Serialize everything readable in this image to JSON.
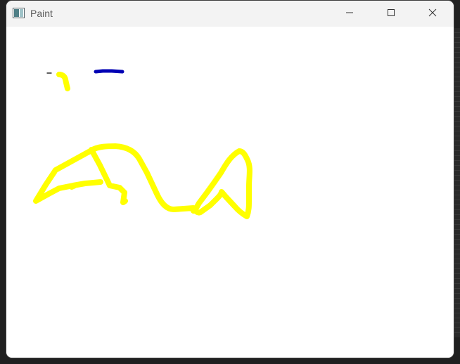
{
  "window": {
    "title": "Paint",
    "icon": "paint-app-icon"
  },
  "caption_buttons": {
    "minimize_icon": "minimize-icon",
    "maximize_icon": "maximize-icon",
    "close_icon": "close-icon"
  },
  "canvas": {
    "background": "#ffffff",
    "stroke_colors": {
      "black": "#000000",
      "blue": "#0000b4",
      "yellow": "#ffff00"
    }
  }
}
